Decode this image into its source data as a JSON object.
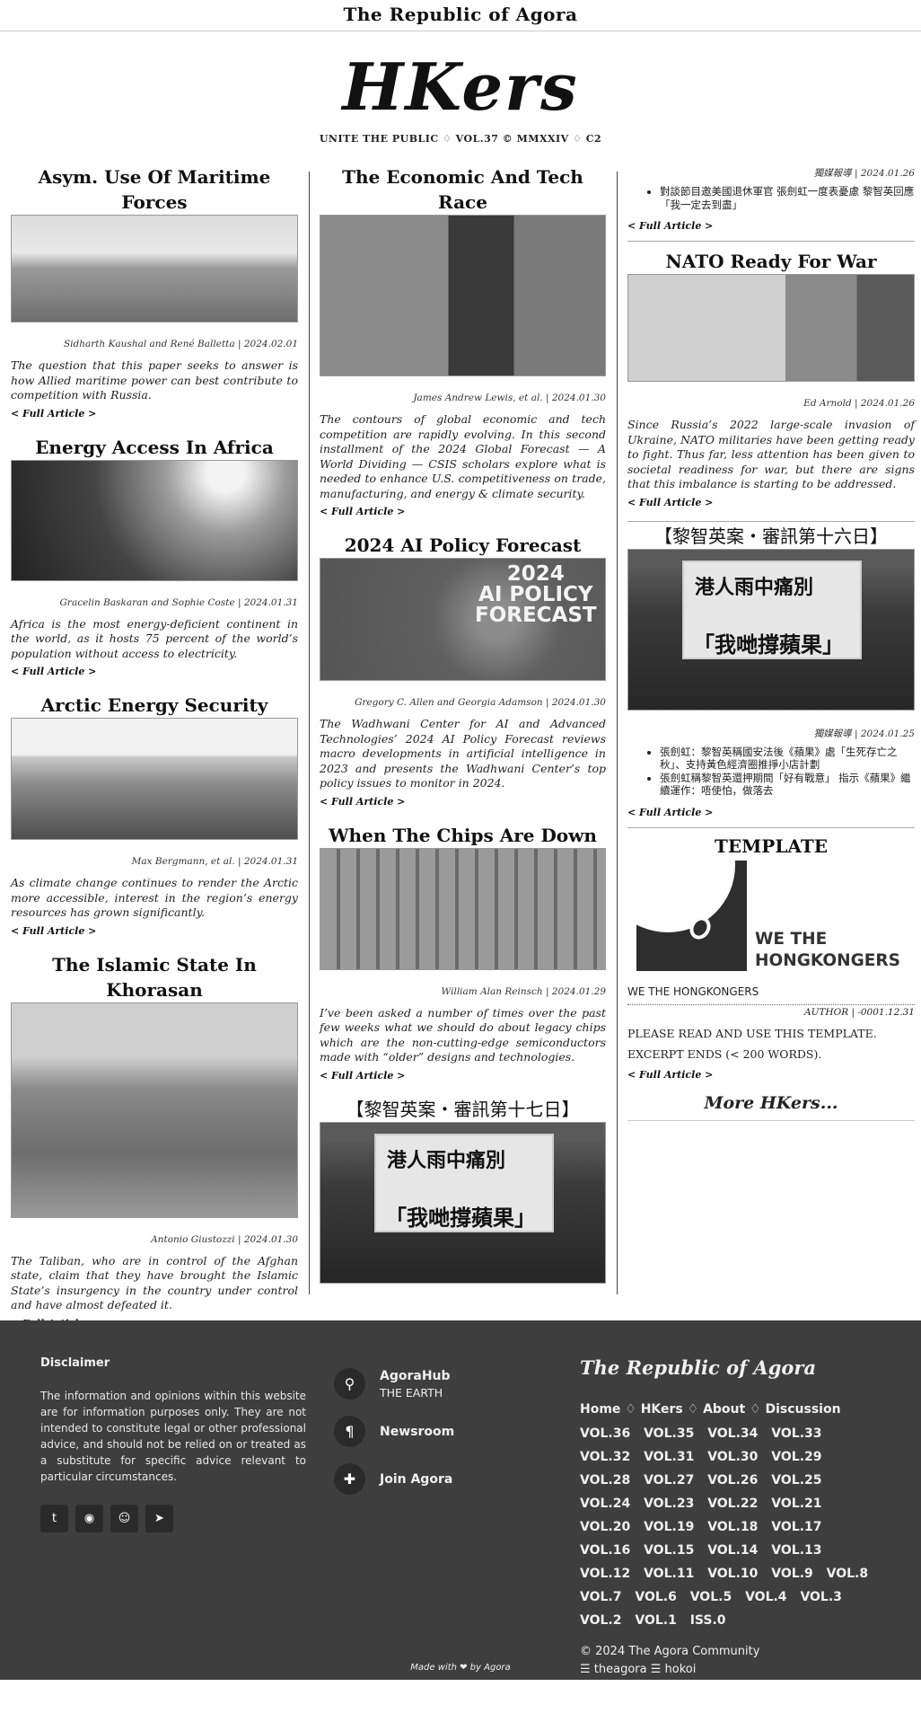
{
  "topbar": {
    "title": "The Republic of Agora"
  },
  "masthead": {
    "title": "HKers",
    "tagline": "UNITE THE PUBLIC ♢ VOL.37 © MMXXIV ♢ C2"
  },
  "full_article_label": "< Full Article >",
  "col1": [
    {
      "title": "Asym. Use Of Maritime Forces",
      "byline": "Sidharth Kaushal and René Balletta | 2024.02.01",
      "excerpt": "The question that this paper seeks to answer is how Allied maritime power can best contribute to competition with Russia."
    },
    {
      "title": "Energy Access In Africa",
      "byline": "Gracelin Baskaran and Sophie Coste | 2024.01.31",
      "excerpt": "Africa is the most energy-deficient continent in the world, as it hosts 75 percent of the world’s population without access to electricity."
    },
    {
      "title": "Arctic Energy Security",
      "byline": "Max Bergmann, et al. | 2024.01.31",
      "excerpt": "As climate change continues to render the Arctic more accessible, interest in the region’s energy resources has grown significantly."
    },
    {
      "title": "The Islamic State In Khorasan",
      "byline": "Antonio Giustozzi | 2024.01.30",
      "excerpt": "The Taliban, who are in control of the Afghan state, claim that they have brought the Islamic State’s insurgency in the country under control and have almost defeated it."
    }
  ],
  "col2": [
    {
      "title": "The Economic And Tech Race",
      "byline": "James Andrew Lewis, et al. | 2024.01.30",
      "excerpt": "The contours of global economic and tech competition are rapidly evolving. In this second installment of the 2024 Global Forecast — A World Dividing — CSIS scholars explore what is needed to enhance U.S. competitiveness on trade, manufacturing, and energy & climate security."
    },
    {
      "title": "2024 AI Policy Forecast",
      "image_text": [
        "2024",
        "AI POLICY",
        "FORECAST"
      ],
      "byline": "Gregory C. Allen and Georgia Adamson | 2024.01.30",
      "excerpt": "The Wadhwani Center for AI and Advanced Technologies’ 2024 AI Policy Forecast reviews macro developments in artificial intelligence in 2023 and presents the Wadhwani Center’s top policy issues to monitor in 2024."
    },
    {
      "title": "When The Chips Are Down",
      "byline": "William Alan Reinsch | 2024.01.29",
      "excerpt": "I’ve been asked a number of times over the past few weeks what we should do about legacy chips which are the non-cutting-edge semiconductors made with “older” designs and technologies."
    },
    {
      "title": "【黎智英案・審訊第十七日】",
      "image_text": [
        "港人雨中痛別",
        "「我哋撐蘋果」"
      ]
    }
  ],
  "col3": {
    "top": {
      "byline": "獨媒報導 | 2024.01.26",
      "bullets": [
        "對談節目邀美國退休軍官 張劍虹一度表憂慮 黎智英回應「我一定去到盡」"
      ]
    },
    "nato": {
      "title": "NATO Ready For War",
      "byline": "Ed Arnold | 2024.01.26",
      "excerpt": "Since Russia’s 2022 large-scale invasion of Ukraine, NATO militaries have been getting ready to fight. Thus far, less attention has been given to societal readiness for war, but there are signs that this imbalance is starting to be addressed."
    },
    "lai16": {
      "title": "【黎智英案・審訊第十六日】",
      "image_text": [
        "港人雨中痛別",
        "「我哋撐蘋果」"
      ],
      "byline": "獨媒報導 | 2024.01.25",
      "bullets": [
        "張劍虹：黎智英稱國安法後《蘋果》處「生死存亡之秋」、支持黃色經濟圈推掙小店計劃",
        "張劍虹稱黎智英還押期間「好有戰意」 指示《蘋果》繼續運作：唔使怕，做落去"
      ]
    },
    "template": {
      "title": "TEMPLATE",
      "logo_text": [
        "WE THE",
        "HONGKONGERS"
      ],
      "name": "WE THE HONGKONGERS",
      "byline": "AUTHOR | -0001.12.31",
      "body": [
        "PLEASE READ AND USE THIS TEMPLATE.",
        "EXCERPT ENDS (< 200 WORDS)."
      ]
    },
    "more": "More HKers..."
  },
  "footer": {
    "disclaimer_title": "Disclaimer",
    "disclaimer_text": "The information and opinions within this website are for information purposes only. They are not intended to constitute legal or other professional advice, and should not be relied on or treated as a substitute for specific advice relevant to particular circumstances.",
    "socials": [
      "twitter-icon",
      "github-icon",
      "reddit-icon",
      "telegram-icon"
    ],
    "links": [
      {
        "label": "AgoraHub",
        "sub": "THE EARTH",
        "icon": "map-pin-icon"
      },
      {
        "label": "Newsroom",
        "sub": "",
        "icon": "pilcrow-icon"
      },
      {
        "label": "Join Agora",
        "sub": "",
        "icon": "puzzle-icon"
      }
    ],
    "brand": "The Republic of Agora",
    "nav": "Home ♢ HKers ♢ About ♢ Discussion",
    "vols": [
      "VOL.36",
      "VOL.35",
      "VOL.34",
      "VOL.33",
      "VOL.32",
      "VOL.31",
      "VOL.30",
      "VOL.29",
      "VOL.28",
      "VOL.27",
      "VOL.26",
      "VOL.25",
      "VOL.24",
      "VOL.23",
      "VOL.22",
      "VOL.21",
      "VOL.20",
      "VOL.19",
      "VOL.18",
      "VOL.17",
      "VOL.16",
      "VOL.15",
      "VOL.14",
      "VOL.13",
      "VOL.12",
      "VOL.11",
      "VOL.10",
      "VOL.9",
      "VOL.8",
      "VOL.7",
      "VOL.6",
      "VOL.5",
      "VOL.4",
      "VOL.3",
      "VOL.2",
      "VOL.1",
      "ISS.0"
    ],
    "copyright": "© 2024 The Agora Community",
    "credits": "☰ theagora ☰ hokoi",
    "madewith": "Made with ❤ by Agora"
  }
}
